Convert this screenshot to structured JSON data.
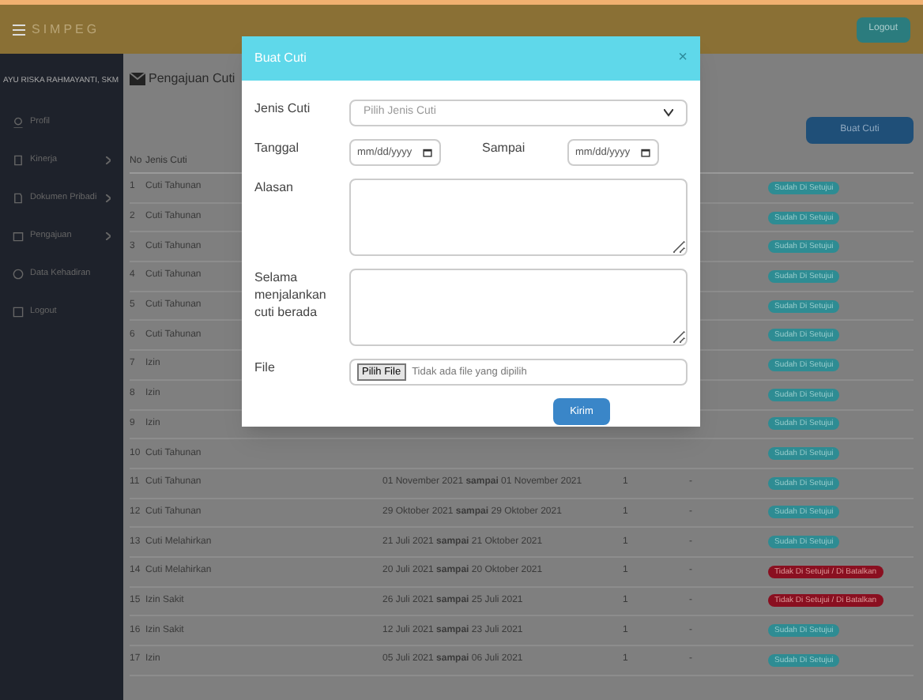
{
  "app": {
    "logo": "SIMPEG",
    "logout": "Logout"
  },
  "sidebar": {
    "user": "AYU RISKA RAHMAYANTI, SKM",
    "items": [
      {
        "label": "Profil",
        "expandable": false
      },
      {
        "label": "Kinerja",
        "expandable": true
      },
      {
        "label": "Dokumen Pribadi",
        "expandable": true
      },
      {
        "label": "Pengajuan",
        "expandable": true
      },
      {
        "label": "Data Kehadiran",
        "expandable": false
      },
      {
        "label": "Logout",
        "expandable": false
      }
    ]
  },
  "page": {
    "title": "Pengajuan Cuti",
    "create_button": "Buat Cuti"
  },
  "table": {
    "columns": [
      "No",
      "Jenis Cuti"
    ],
    "rows": [
      {
        "no": "1",
        "type": "Cuti Tahunan",
        "status": "Sudah Di Setujui",
        "approved": true
      },
      {
        "no": "2",
        "type": "Cuti Tahunan",
        "status": "Sudah Di Setujui",
        "approved": true
      },
      {
        "no": "3",
        "type": "Cuti Tahunan",
        "status": "Sudah Di Setujui",
        "approved": true
      },
      {
        "no": "4",
        "type": "Cuti Tahunan",
        "status": "Sudah Di Setujui",
        "approved": true
      },
      {
        "no": "5",
        "type": "Cuti Tahunan",
        "status": "Sudah Di Setujui",
        "approved": true
      },
      {
        "no": "6",
        "type": "Cuti Tahunan",
        "status": "Sudah Di Setujui",
        "approved": true
      },
      {
        "no": "7",
        "type": "Izin",
        "status": "Sudah Di Setujui",
        "approved": true
      },
      {
        "no": "8",
        "type": "Izin",
        "status": "Sudah Di Setujui",
        "approved": true
      },
      {
        "no": "9",
        "type": "Izin",
        "status": "Sudah Di Setujui",
        "approved": true
      },
      {
        "no": "10",
        "type": "Cuti Tahunan",
        "status": "Sudah Di Setujui",
        "approved": true
      },
      {
        "no": "11",
        "type": "Cuti Tahunan",
        "date_from": "01 November 2021",
        "date_to": "01 November 2021",
        "joiner": "sampai",
        "days": "1",
        "note": "-",
        "status": "Sudah Di Setujui",
        "approved": true
      },
      {
        "no": "12",
        "type": "Cuti Tahunan",
        "date_from": "29 Oktober 2021",
        "date_to": "29 Oktober 2021",
        "joiner": "sampai",
        "days": "1",
        "note": "-",
        "status": "Sudah Di Setujui",
        "approved": true
      },
      {
        "no": "13",
        "type": "Cuti Melahirkan",
        "date_from": "21 Juli 2021",
        "date_to": "21 Oktober 2021",
        "joiner": "sampai",
        "days": "1",
        "note": "-",
        "status": "Sudah Di Setujui",
        "approved": true
      },
      {
        "no": "14",
        "type": "Cuti Melahirkan",
        "date_from": "20 Juli 2021",
        "date_to": "20 Oktober 2021",
        "joiner": "sampai",
        "days": "1",
        "note": "-",
        "status": "Tidak Di Setujui / Di Batalkan",
        "approved": false
      },
      {
        "no": "15",
        "type": "Izin Sakit",
        "date_from": "26 Juli 2021",
        "date_to": "25 Juli 2021",
        "joiner": "sampai",
        "days": "1",
        "note": "-",
        "status": "Tidak Di Setujui / Di Batalkan",
        "approved": false
      },
      {
        "no": "16",
        "type": "Izin Sakit",
        "date_from": "12 Juli 2021",
        "date_to": "23 Juli 2021",
        "joiner": "sampai",
        "days": "1",
        "note": "-",
        "status": "Sudah Di Setujui",
        "approved": true
      },
      {
        "no": "17",
        "type": "Izin",
        "date_from": "05 Juli 2021",
        "date_to": "06 Juli 2021",
        "joiner": "sampai",
        "days": "1",
        "note": "-",
        "status": "Sudah Di Setujui",
        "approved": true
      }
    ]
  },
  "modal": {
    "title": "Buat Cuti",
    "close": "×",
    "fields": [
      {
        "kind": "select",
        "label": "Jenis Cuti",
        "placeholder": "Pilih Jenis Cuti"
      },
      {
        "kind": "dates",
        "label": "Tanggal",
        "value": "mm/dd/yyyy",
        "label2": "Sampai",
        "value2": "mm/dd/yyyy"
      },
      {
        "kind": "textarea",
        "label": "Alasan"
      },
      {
        "kind": "textarea",
        "label": "Selama menjalankan cuti berada"
      },
      {
        "kind": "file",
        "label": "File",
        "button": "Pilih File",
        "status": "Tidak ada file yang dipilih"
      }
    ],
    "submit": "Kirim"
  }
}
